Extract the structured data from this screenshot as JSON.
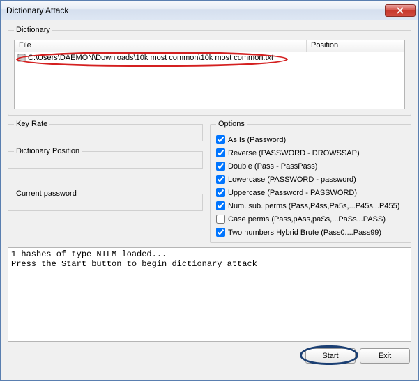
{
  "window": {
    "title": "Dictionary Attack"
  },
  "dictionary": {
    "legend": "Dictionary",
    "columns": {
      "file": "File",
      "position": "Position"
    },
    "rows": [
      {
        "file": "C:\\Users\\DAEMON\\Downloads\\10k most common\\10k most common.txt",
        "position": ""
      }
    ]
  },
  "keyRate": {
    "legend": "Key Rate",
    "value": ""
  },
  "dictPosition": {
    "legend": "Dictionary Position",
    "value": ""
  },
  "currentPassword": {
    "legend": "Current password",
    "value": ""
  },
  "options": {
    "legend": "Options",
    "items": [
      {
        "label": "As Is (Password)",
        "checked": true
      },
      {
        "label": "Reverse (PASSWORD - DROWSSAP)",
        "checked": true
      },
      {
        "label": "Double (Pass - PassPass)",
        "checked": true
      },
      {
        "label": "Lowercase (PASSWORD - password)",
        "checked": true
      },
      {
        "label": "Uppercase (Password - PASSWORD)",
        "checked": true
      },
      {
        "label": "Num. sub. perms (Pass,P4ss,Pa5s,...P45s...P455)",
        "checked": true
      },
      {
        "label": "Case perms (Pass,pAss,paSs,...PaSs...PASS)",
        "checked": false
      },
      {
        "label": "Two numbers Hybrid Brute (Pass0....Pass99)",
        "checked": true
      }
    ]
  },
  "log": {
    "text": "1 hashes of type NTLM loaded...\nPress the Start button to begin dictionary attack"
  },
  "buttons": {
    "start": "Start",
    "exit": "Exit"
  }
}
